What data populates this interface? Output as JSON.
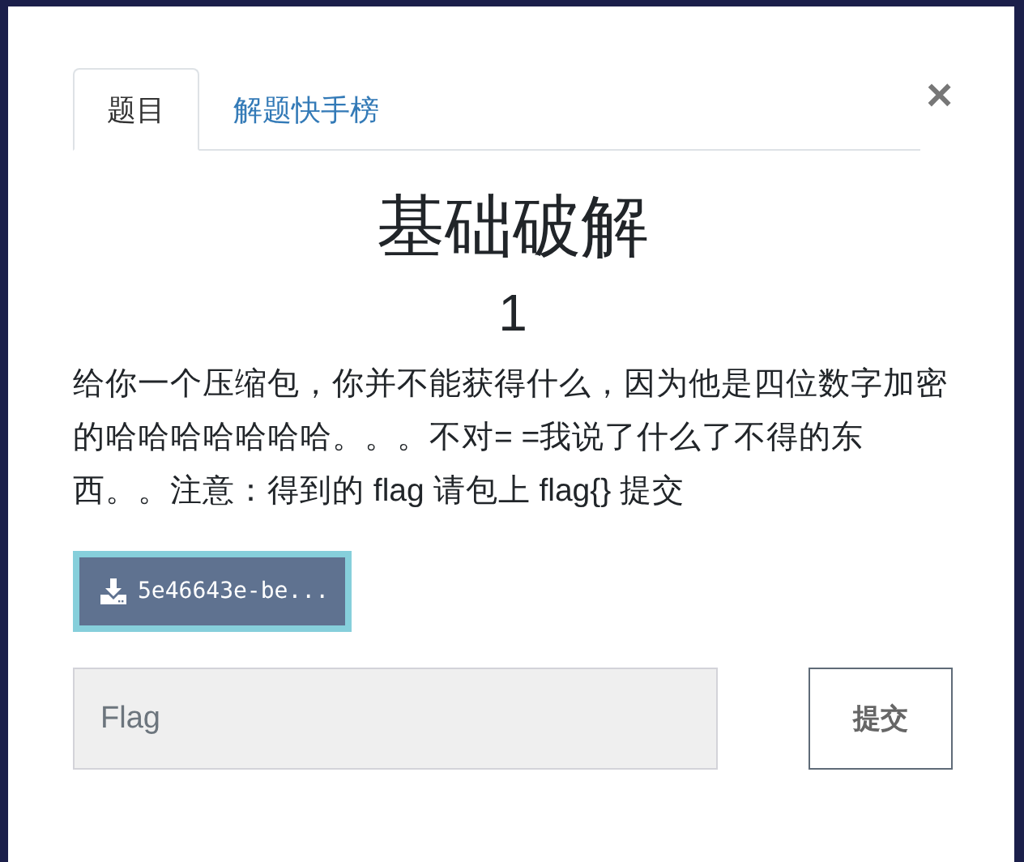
{
  "tabs": [
    {
      "label": "题目",
      "selected": true
    },
    {
      "label": "解题快手榜",
      "selected": false
    }
  ],
  "close": "×",
  "challenge": {
    "title": "基础破解",
    "points": "1",
    "description": "给你一个压缩包，你并不能获得什么，因为他是四位数字加密的哈哈哈哈哈哈哈。。。不对= =我说了什么了不得的东西。。注意：得到的 flag 请包上 flag{} 提交",
    "file": "5e46643e-be..."
  },
  "flag_input": {
    "placeholder": "Flag"
  },
  "submit": "提交"
}
